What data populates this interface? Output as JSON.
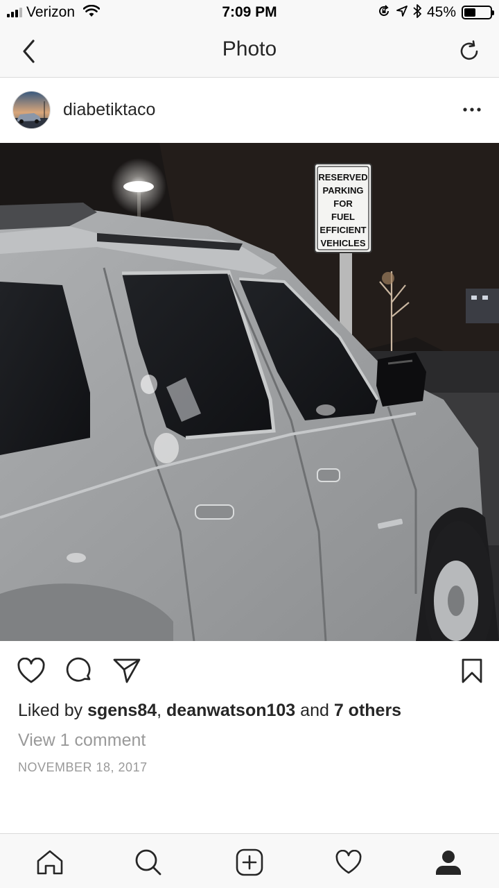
{
  "status_bar": {
    "carrier": "Verizon",
    "time": "7:09 PM",
    "battery_percent": "45%",
    "battery_level": 0.45,
    "signal_bars": 3
  },
  "nav": {
    "title": "Photo",
    "back_icon": "chevron-left-icon",
    "refresh_icon": "refresh-icon"
  },
  "post": {
    "username": "diabetiktaco",
    "more_icon": "ellipsis-icon",
    "photo_sign": {
      "lines": [
        "RESERVED",
        "PARKING",
        "FOR",
        "FUEL",
        "EFFICIENT",
        "VEHICLES"
      ]
    },
    "likes": {
      "prefix": "Liked by ",
      "user1": "sgens84",
      "separator": ", ",
      "user2": "deanwatson103",
      "conjunction": " and ",
      "others": "7 others"
    },
    "view_comments": "View 1 comment",
    "date": "NOVEMBER 18, 2017"
  },
  "tab_bar": {
    "items": [
      {
        "name": "home",
        "icon": "home-icon"
      },
      {
        "name": "search",
        "icon": "search-icon"
      },
      {
        "name": "new-post",
        "icon": "plus-square-icon"
      },
      {
        "name": "activity",
        "icon": "heart-icon"
      },
      {
        "name": "profile",
        "icon": "profile-icon"
      }
    ]
  },
  "colors": {
    "text": "#262626",
    "secondary_text": "#999999",
    "bar_background": "#f8f8f8",
    "divider": "#dbdbdb"
  }
}
